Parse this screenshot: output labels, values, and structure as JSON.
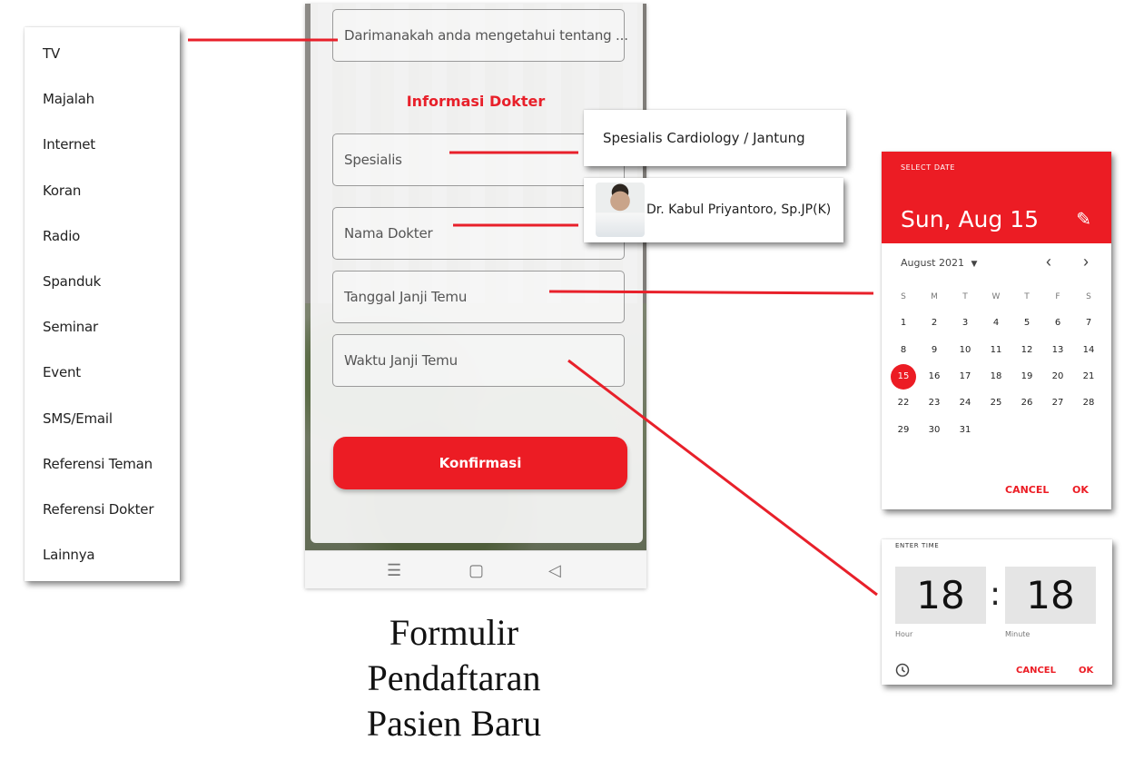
{
  "source_menu": {
    "items": [
      "TV",
      "Majalah",
      "Internet",
      "Koran",
      "Radio",
      "Spanduk",
      "Seminar",
      "Event",
      "SMS/Email",
      "Referensi Teman",
      "Referensi Dokter",
      "Lainnya"
    ]
  },
  "form": {
    "source_placeholder": "Darimanakah anda mengetahui tentang ...",
    "section_title": "Informasi Dokter",
    "specialist_placeholder": "Spesialis",
    "doctor_placeholder": "Nama Dokter",
    "date_placeholder": "Tanggal Janji Temu",
    "time_placeholder": "Waktu Janji Temu",
    "confirm_label": "Konfirmasi"
  },
  "caption": {
    "line1": "Formulir",
    "line2": "Pendaftaran",
    "line3": "Pasien Baru"
  },
  "specialist_popup": {
    "option": "Spesialis Cardiology / Jantung"
  },
  "doctor_popup": {
    "option": "Dr. Kabul Priyantoro, Sp.JP(K)"
  },
  "date_picker": {
    "label": "SELECT DATE",
    "selected_date": "Sun, Aug 15",
    "month_label": "August 2021",
    "weekdays": [
      "S",
      "M",
      "T",
      "W",
      "T",
      "F",
      "S"
    ],
    "selected_day": 15,
    "cancel_label": "CANCEL",
    "ok_label": "OK"
  },
  "time_picker": {
    "label": "ENTER TIME",
    "hour": "18",
    "minute": "18",
    "hour_label": "Hour",
    "minute_label": "Minute",
    "cancel_label": "CANCEL",
    "ok_label": "OK"
  },
  "colors": {
    "accent": "#ec1c24",
    "connector": "#e8202a"
  }
}
